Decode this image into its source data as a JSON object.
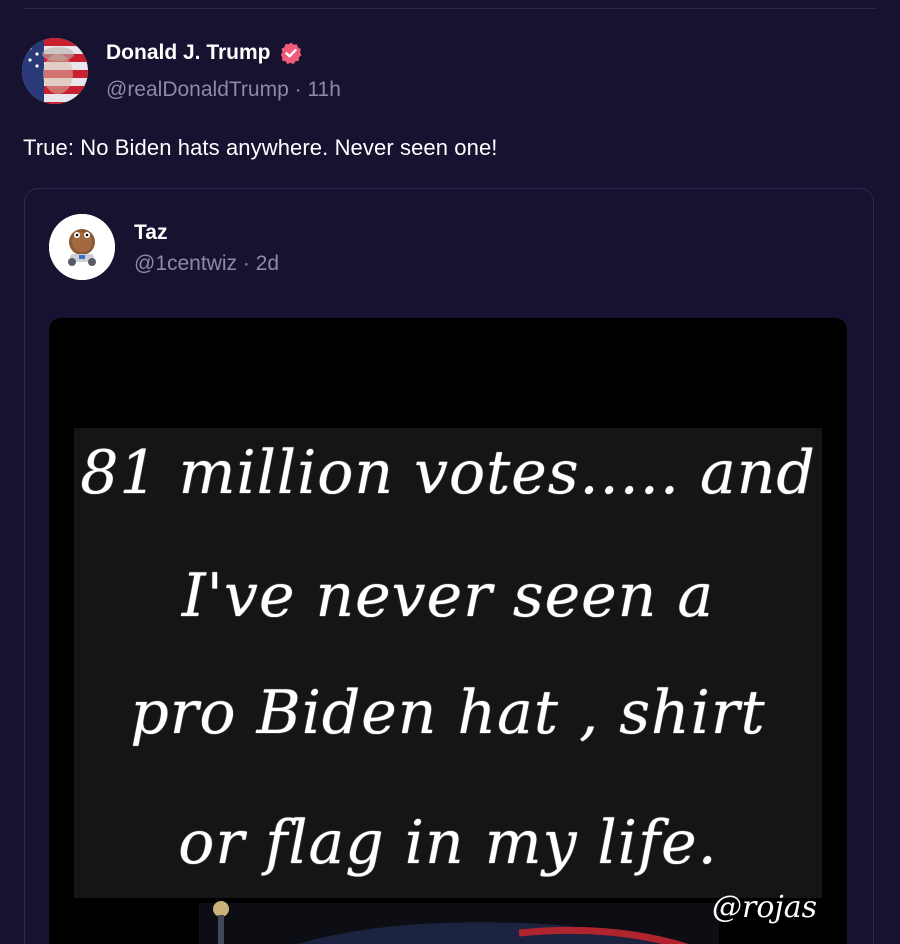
{
  "post": {
    "author_name": "Donald J. Trump",
    "author_handle_time": "@realDonaldTrump · 11h",
    "text": "True: No Biden hats anywhere. Never seen one!",
    "verified_color": "#f05b7a"
  },
  "quote": {
    "author_name": "Taz",
    "author_handle_time": "@1centwiz · 2d",
    "image_lines": [
      "81 million votes..... and",
      "I've never seen a",
      "pro Biden hat , shirt",
      "or flag in my life."
    ],
    "watermark": "@rojas"
  },
  "icons": {
    "verified": "verified-badge-icon",
    "avatar_main": "flag-portrait-avatar",
    "avatar_quote": "coin-character-avatar"
  }
}
